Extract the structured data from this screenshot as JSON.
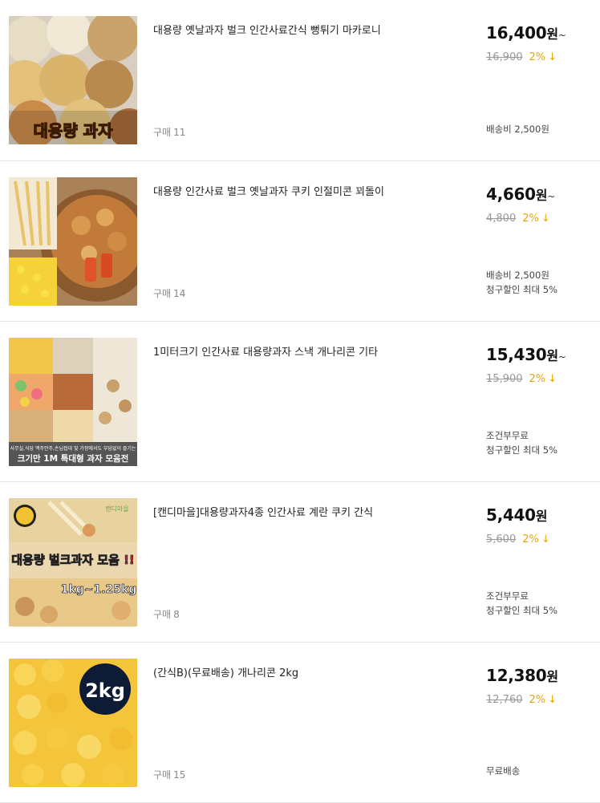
{
  "products": [
    {
      "thumb_caption": "대용량 과자",
      "title": "대용량 옛날과자 벌크 인간사료간식 뻥튀기 마카로니",
      "price": "16,400",
      "currency": "원",
      "price_suffix": "~",
      "original_price": "16,900",
      "discount": "2%",
      "arrow": "↓",
      "purchase_label": "구매",
      "purchase_count": "11",
      "shipping": [
        "배송비 2,500원"
      ]
    },
    {
      "thumb_caption": "",
      "title": "대용량 인간사료 벌크 옛날과자 쿠키 인절미콘 꾀돌이",
      "price": "4,660",
      "currency": "원",
      "price_suffix": "~",
      "original_price": "4,800",
      "discount": "2%",
      "arrow": "↓",
      "purchase_label": "구매",
      "purchase_count": "14",
      "shipping": [
        "배송비 2,500원",
        "청구할인 최대 5%"
      ]
    },
    {
      "thumb_caption": "크기만 1M 특대형 과자 모음전",
      "thumb_subcaption": "사무실,식당 맥주안주,손님접대 및 가정에서도 부담없이 즐기는",
      "title": "1미터크기 인간사료 대용량과자 스낵 개나리콘 기타",
      "price": "15,430",
      "currency": "원",
      "price_suffix": "~",
      "original_price": "15,900",
      "discount": "2%",
      "arrow": "↓",
      "purchase_label": "",
      "purchase_count": "",
      "shipping": [
        "조건부무료",
        "청구할인 최대 5%"
      ]
    },
    {
      "thumb_caption": "대용량 벌크과자 모음 !!",
      "thumb_subcaption": "1kg~1.25kg",
      "thumb_brand": "캔디마을",
      "title": "[캔디마을]대용량과자4종 인간사료 계란 쿠키 간식",
      "price": "5,440",
      "currency": "원",
      "price_suffix": "",
      "original_price": "5,600",
      "discount": "2%",
      "arrow": "↓",
      "purchase_label": "구매",
      "purchase_count": "8",
      "shipping": [
        "조건부무료",
        "청구할인 최대 5%"
      ]
    },
    {
      "thumb_caption": "2kg",
      "title": "(간식B)(무료배송) 개나리콘 2kg",
      "price": "12,380",
      "currency": "원",
      "price_suffix": "",
      "original_price": "12,760",
      "discount": "2%",
      "arrow": "↓",
      "purchase_label": "구매",
      "purchase_count": "15",
      "shipping": [
        "무료배송"
      ]
    }
  ]
}
